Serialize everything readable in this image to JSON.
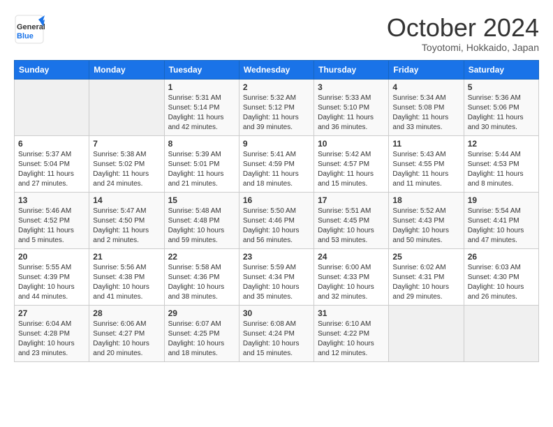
{
  "header": {
    "logo_general": "General",
    "logo_blue": "Blue",
    "month": "October 2024",
    "location": "Toyotomi, Hokkaido, Japan"
  },
  "weekdays": [
    "Sunday",
    "Monday",
    "Tuesday",
    "Wednesday",
    "Thursday",
    "Friday",
    "Saturday"
  ],
  "weeks": [
    [
      {
        "day": "",
        "info": ""
      },
      {
        "day": "",
        "info": ""
      },
      {
        "day": "1",
        "info": "Sunrise: 5:31 AM\nSunset: 5:14 PM\nDaylight: 11 hours and 42 minutes."
      },
      {
        "day": "2",
        "info": "Sunrise: 5:32 AM\nSunset: 5:12 PM\nDaylight: 11 hours and 39 minutes."
      },
      {
        "day": "3",
        "info": "Sunrise: 5:33 AM\nSunset: 5:10 PM\nDaylight: 11 hours and 36 minutes."
      },
      {
        "day": "4",
        "info": "Sunrise: 5:34 AM\nSunset: 5:08 PM\nDaylight: 11 hours and 33 minutes."
      },
      {
        "day": "5",
        "info": "Sunrise: 5:36 AM\nSunset: 5:06 PM\nDaylight: 11 hours and 30 minutes."
      }
    ],
    [
      {
        "day": "6",
        "info": "Sunrise: 5:37 AM\nSunset: 5:04 PM\nDaylight: 11 hours and 27 minutes."
      },
      {
        "day": "7",
        "info": "Sunrise: 5:38 AM\nSunset: 5:02 PM\nDaylight: 11 hours and 24 minutes."
      },
      {
        "day": "8",
        "info": "Sunrise: 5:39 AM\nSunset: 5:01 PM\nDaylight: 11 hours and 21 minutes."
      },
      {
        "day": "9",
        "info": "Sunrise: 5:41 AM\nSunset: 4:59 PM\nDaylight: 11 hours and 18 minutes."
      },
      {
        "day": "10",
        "info": "Sunrise: 5:42 AM\nSunset: 4:57 PM\nDaylight: 11 hours and 15 minutes."
      },
      {
        "day": "11",
        "info": "Sunrise: 5:43 AM\nSunset: 4:55 PM\nDaylight: 11 hours and 11 minutes."
      },
      {
        "day": "12",
        "info": "Sunrise: 5:44 AM\nSunset: 4:53 PM\nDaylight: 11 hours and 8 minutes."
      }
    ],
    [
      {
        "day": "13",
        "info": "Sunrise: 5:46 AM\nSunset: 4:52 PM\nDaylight: 11 hours and 5 minutes."
      },
      {
        "day": "14",
        "info": "Sunrise: 5:47 AM\nSunset: 4:50 PM\nDaylight: 11 hours and 2 minutes."
      },
      {
        "day": "15",
        "info": "Sunrise: 5:48 AM\nSunset: 4:48 PM\nDaylight: 10 hours and 59 minutes."
      },
      {
        "day": "16",
        "info": "Sunrise: 5:50 AM\nSunset: 4:46 PM\nDaylight: 10 hours and 56 minutes."
      },
      {
        "day": "17",
        "info": "Sunrise: 5:51 AM\nSunset: 4:45 PM\nDaylight: 10 hours and 53 minutes."
      },
      {
        "day": "18",
        "info": "Sunrise: 5:52 AM\nSunset: 4:43 PM\nDaylight: 10 hours and 50 minutes."
      },
      {
        "day": "19",
        "info": "Sunrise: 5:54 AM\nSunset: 4:41 PM\nDaylight: 10 hours and 47 minutes."
      }
    ],
    [
      {
        "day": "20",
        "info": "Sunrise: 5:55 AM\nSunset: 4:39 PM\nDaylight: 10 hours and 44 minutes."
      },
      {
        "day": "21",
        "info": "Sunrise: 5:56 AM\nSunset: 4:38 PM\nDaylight: 10 hours and 41 minutes."
      },
      {
        "day": "22",
        "info": "Sunrise: 5:58 AM\nSunset: 4:36 PM\nDaylight: 10 hours and 38 minutes."
      },
      {
        "day": "23",
        "info": "Sunrise: 5:59 AM\nSunset: 4:34 PM\nDaylight: 10 hours and 35 minutes."
      },
      {
        "day": "24",
        "info": "Sunrise: 6:00 AM\nSunset: 4:33 PM\nDaylight: 10 hours and 32 minutes."
      },
      {
        "day": "25",
        "info": "Sunrise: 6:02 AM\nSunset: 4:31 PM\nDaylight: 10 hours and 29 minutes."
      },
      {
        "day": "26",
        "info": "Sunrise: 6:03 AM\nSunset: 4:30 PM\nDaylight: 10 hours and 26 minutes."
      }
    ],
    [
      {
        "day": "27",
        "info": "Sunrise: 6:04 AM\nSunset: 4:28 PM\nDaylight: 10 hours and 23 minutes."
      },
      {
        "day": "28",
        "info": "Sunrise: 6:06 AM\nSunset: 4:27 PM\nDaylight: 10 hours and 20 minutes."
      },
      {
        "day": "29",
        "info": "Sunrise: 6:07 AM\nSunset: 4:25 PM\nDaylight: 10 hours and 18 minutes."
      },
      {
        "day": "30",
        "info": "Sunrise: 6:08 AM\nSunset: 4:24 PM\nDaylight: 10 hours and 15 minutes."
      },
      {
        "day": "31",
        "info": "Sunrise: 6:10 AM\nSunset: 4:22 PM\nDaylight: 10 hours and 12 minutes."
      },
      {
        "day": "",
        "info": ""
      },
      {
        "day": "",
        "info": ""
      }
    ]
  ]
}
